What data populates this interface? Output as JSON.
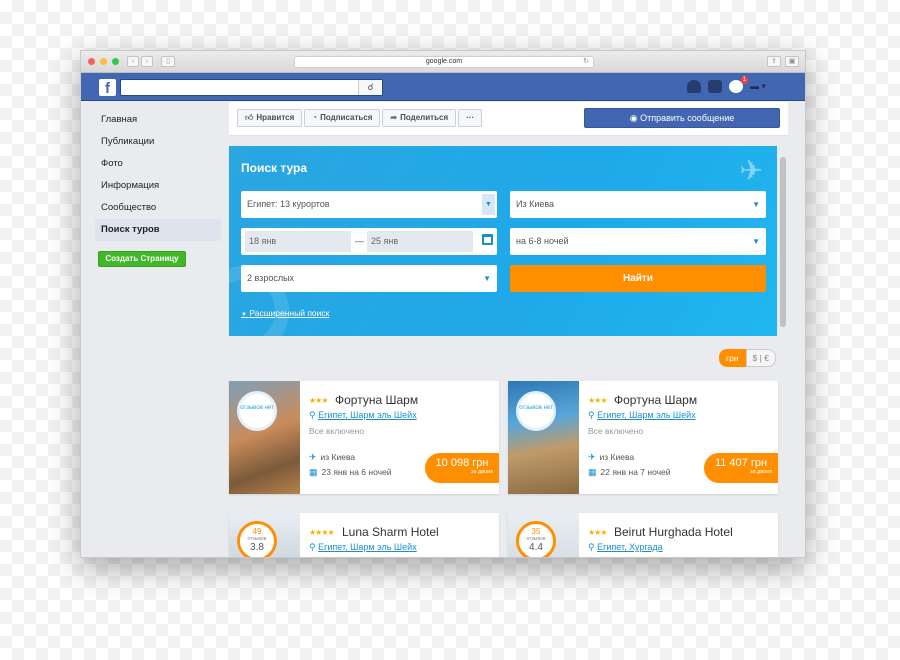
{
  "browser": {
    "url": "google.com",
    "traffic_colors": [
      "#fc605c",
      "#fdbc40",
      "#34c84a"
    ]
  },
  "fb": {
    "logo": "f",
    "notification_count": "1"
  },
  "sidebar": {
    "items": [
      {
        "label": "Главная"
      },
      {
        "label": "Публикации"
      },
      {
        "label": "Фото"
      },
      {
        "label": "Информация"
      },
      {
        "label": "Сообщество"
      },
      {
        "label": "Поиск туров"
      }
    ],
    "create_button": "Создать Страницу"
  },
  "actions": {
    "like": "Нравится",
    "follow": "Подписаться",
    "share": "Поделиться",
    "more": "···",
    "send_message": "Отправить сообщение"
  },
  "search": {
    "title": "Поиск тура",
    "destination": "Египет: 13 курортов",
    "from": "Из Киева",
    "date_from": "18 янв",
    "date_sep": "—",
    "date_to": "25 янв",
    "nights": "на 6-8 ночей",
    "guests": "2 взрослых",
    "submit": "Найти",
    "advanced": "Расширенный поиск"
  },
  "currency": {
    "active": "грн",
    "inactive": "$ | €"
  },
  "cards": [
    {
      "review_label": "отзывов нет",
      "stars": "★★★",
      "name": "Фортуна Шарм",
      "location": "Египет, Шарм эль Шейх",
      "meal": "Все включено",
      "depart": "из Киева",
      "dates": "23 янв на 6 ночей",
      "price": "10 098 грн",
      "price_note": "за двоих"
    },
    {
      "review_label": "отзывов нет",
      "stars": "★★★",
      "name": "Фортуна Шарм",
      "location": "Египет, Шарм эль Шейх",
      "meal": "Все включено",
      "depart": "из Киева",
      "dates": "22 янв на 7 ночей",
      "price": "11 407 грн",
      "price_note": "за двоих"
    },
    {
      "review_count": "49",
      "review_word": "отзывов",
      "score": "3.8",
      "stars": "★★★★",
      "name": "Luna Sharm Hotel",
      "location": "Египет, Шарм эль Шейх"
    },
    {
      "review_count": "35",
      "review_word": "отзывов",
      "score": "4.4",
      "stars": "★★★",
      "name": "Beirut Hurghada Hotel",
      "location": "Египет, Хургада"
    }
  ],
  "icons": {
    "search": "search-icon",
    "plane": "plane-icon",
    "calendar": "calendar-icon",
    "pin": "location-pin-icon"
  },
  "colors": {
    "fb_blue": "#4267b2",
    "widget_blue": "#1fa9e9",
    "accent_orange": "#ff8f00",
    "create_green": "#42b72a"
  }
}
